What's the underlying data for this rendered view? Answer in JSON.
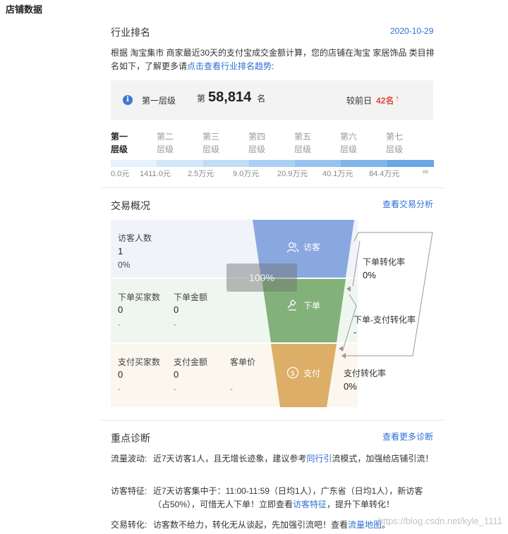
{
  "page_title": "店铺数据",
  "industry": {
    "title": "行业排名",
    "date": "2020-10-29",
    "desc_prefix": "根据 淘宝集市 商家最近30天的支付宝成交金额计算，您的店铺在淘宝 家居饰品 类目排名如下，了解更多请",
    "desc_link": "点击查看行业排名趋势",
    "desc_suffix": ":",
    "tier_label": "第一层级",
    "rank_prefix": "第",
    "rank_value": "58,814",
    "rank_suffix": "名",
    "compare_label": "较前日",
    "compare_value": "42名",
    "compare_arrow": "↑",
    "tiers": [
      {
        "line1": "第一",
        "line2": "层级"
      },
      {
        "line1": "第二",
        "line2": "层级"
      },
      {
        "line1": "第三",
        "line2": "层级"
      },
      {
        "line1": "第四",
        "line2": "层级"
      },
      {
        "line1": "第五",
        "line2": "层级"
      },
      {
        "line1": "第六",
        "line2": "层级"
      },
      {
        "line1": "第七",
        "line2": "层级"
      }
    ],
    "ticks": [
      "0.0元",
      "1411.0元",
      "2.5万元",
      "9.0万元",
      "20.9万元",
      "40.1万元",
      "84.4万元",
      "∞"
    ],
    "bar_colors": [
      "#e6f1fc",
      "#d3e7fa",
      "#c0dcf7",
      "#aacff3",
      "#96c3ef",
      "#80b5ea",
      "#6aa6e4"
    ]
  },
  "trade": {
    "title": "交易概况",
    "link": "查看交易分析",
    "visitors_label": "访客人数",
    "visitors_value": "1",
    "visitors_pct": "0%",
    "order_buyers_label": "下单买家数",
    "order_buyers_value": "0",
    "order_buyers_dash": "-",
    "order_amount_label": "下单金额",
    "order_amount_value": "0",
    "order_amount_dash": "-",
    "pay_buyers_label": "支付买家数",
    "pay_buyers_value": "0",
    "pay_buyers_dash": "-",
    "pay_amount_label": "支付金额",
    "pay_amount_value": "0",
    "pay_amount_dash": "-",
    "unit_price_label": "客单价",
    "unit_price_dash": "-",
    "funnel_visit": "访客",
    "funnel_order": "下单",
    "funnel_pay": "支付",
    "tooltip": "100%",
    "conv_order_label": "下单转化率",
    "conv_order_value": "0%",
    "conv_order_pay_label": "下单-支付转化率",
    "conv_order_pay_value": "-",
    "conv_pay_label": "支付转化率",
    "conv_pay_value": "0%",
    "colors": {
      "visit": "#8aa8e0",
      "order": "#82b27a",
      "pay": "#ddae68"
    }
  },
  "diagnosis": {
    "title": "重点诊断",
    "link": "查看更多诊断",
    "rows": [
      {
        "key": "流量波动:",
        "pre": "近7天访客1人，且无增长迹象，建议参考",
        "link": "同行引",
        "post": "流模式，加强给店铺引流！"
      },
      {
        "key": "访客特征:",
        "pre": "近7天访客集中于：11:00-11:59（日均1人），广东省（日均1人），新访客（占50%），可惜无人下单！立即查看",
        "link": "访客特征",
        "post": "，提升下单转化！"
      },
      {
        "key": "交易转化:",
        "pre": "访客数不给力，转化无从谈起，先加强引流吧！查看",
        "link": "流量地图",
        "post": "。"
      }
    ]
  },
  "watermark": "https://blog.csdn.net/kyle_1111"
}
